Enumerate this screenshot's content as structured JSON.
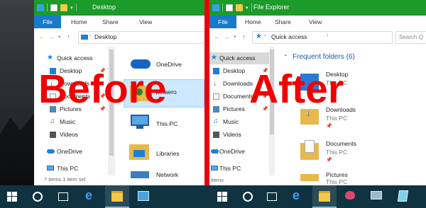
{
  "before_window": {
    "title": "Desktop",
    "ribbon_tabs": [
      "File",
      "Home",
      "Share",
      "View"
    ],
    "address_path": "Desktop",
    "nav_items": [
      {
        "label": "Quick access",
        "icon": "star-icon",
        "pinned": false
      },
      {
        "label": "Desktop",
        "icon": "desktop-folder-icon",
        "pinned": true
      },
      {
        "label": "Downloads",
        "icon": "download-icon",
        "pinned": true
      },
      {
        "label": "Documents",
        "icon": "documents-icon",
        "pinned": true
      },
      {
        "label": "Pictures",
        "icon": "pictures-icon",
        "pinned": true
      },
      {
        "label": "Music",
        "icon": "music-icon",
        "pinned": false
      },
      {
        "label": "Videos",
        "icon": "videos-icon",
        "pinned": false
      },
      {
        "label": "OneDrive",
        "icon": "cloud-icon",
        "pinned": false
      },
      {
        "label": "This PC",
        "icon": "pc-icon",
        "pinned": false
      }
    ],
    "content_items": [
      {
        "label": "OneDrive",
        "icon": "cloud-icon"
      },
      {
        "label": "winaero",
        "icon": "user-folder-icon"
      },
      {
        "label": "This PC",
        "icon": "pc-icon"
      },
      {
        "label": "Libraries",
        "icon": "libraries-icon"
      },
      {
        "label": "Network",
        "icon": "network-icon"
      }
    ],
    "status_text": "7 items   1 item sel"
  },
  "after_window": {
    "title": "File Explorer",
    "ribbon_tabs": [
      "File",
      "Home",
      "Share",
      "View"
    ],
    "address_path": "Quick access",
    "search_placeholder": "Search Q",
    "nav_items": [
      {
        "label": "Quick access",
        "icon": "star-icon",
        "pinned": false
      },
      {
        "label": "Desktop",
        "icon": "desktop-folder-icon",
        "pinned": true
      },
      {
        "label": "Downloads",
        "icon": "download-icon",
        "pinned": true
      },
      {
        "label": "Documents",
        "icon": "documents-icon",
        "pinned": true
      },
      {
        "label": "Pictures",
        "icon": "pictures-icon",
        "pinned": true
      },
      {
        "label": "Music",
        "icon": "music-icon",
        "pinned": false
      },
      {
        "label": "Videos",
        "icon": "videos-icon",
        "pinned": false
      },
      {
        "label": "OneDrive",
        "icon": "cloud-icon",
        "pinned": false
      },
      {
        "label": "This PC",
        "icon": "pc-icon",
        "pinned": false
      }
    ],
    "section_header": "Frequent folders (6)",
    "folders": [
      {
        "name": "Desktop",
        "location": "This PC"
      },
      {
        "name": "Downloads",
        "location": "This PC"
      },
      {
        "name": "Documents",
        "location": "This PC"
      },
      {
        "name": "Pictures",
        "location": "This PC"
      }
    ],
    "status_text": "items"
  },
  "overlay": {
    "before_label": "Before",
    "after_label": "After",
    "color": "#f00000"
  },
  "taskbar": {
    "icons": [
      "start-icon",
      "search-circle-icon",
      "task-view-icon",
      "edge-icon",
      "file-explorer-icon",
      "control-panel-icon",
      "start-icon",
      "search-circle-icon",
      "task-view-icon",
      "edge-icon",
      "file-explorer-icon",
      "paint-icon",
      "network-settings-icon",
      "notepad-icon"
    ]
  },
  "colors": {
    "titlebar": "#1c9a2a",
    "file_tab": "#1979ca",
    "taskbar": "#0f3340",
    "divider": "#e8000a"
  }
}
